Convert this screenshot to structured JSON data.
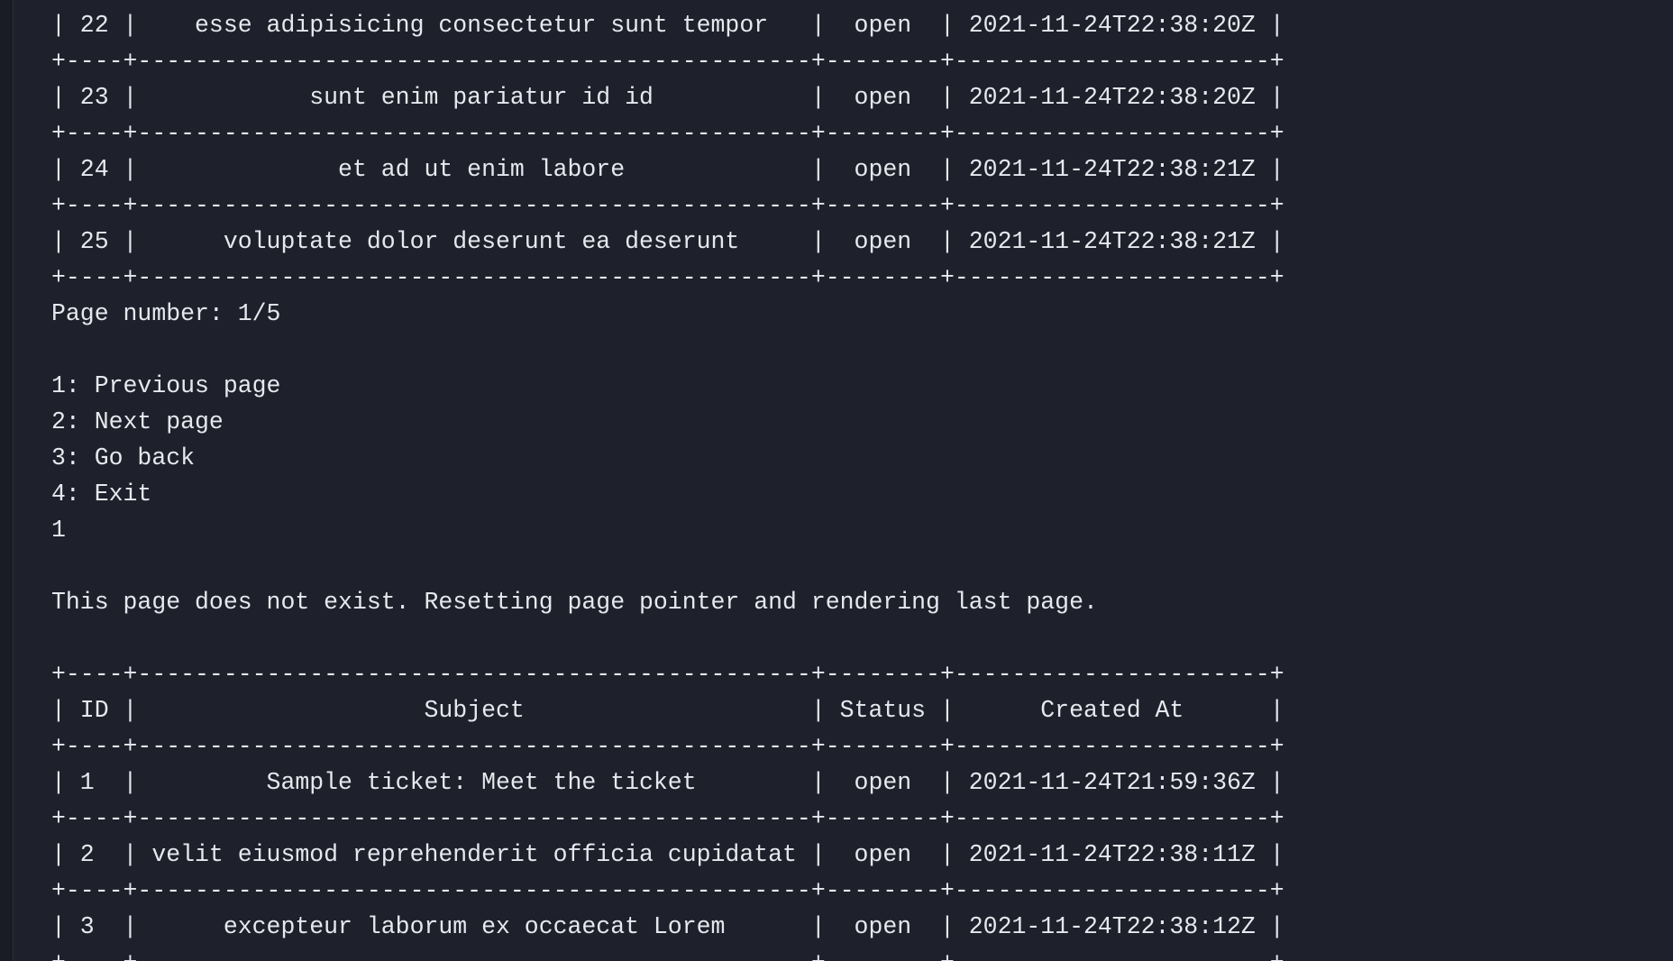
{
  "terminal": {
    "lines": [
      "| 22 |    esse adipisicing consectetur sunt tempor   |  open  | 2021-11-24T22:38:20Z |",
      "+----+-----------------------------------------------+--------+----------------------+",
      "| 23 |            sunt enim pariatur id id           |  open  | 2021-11-24T22:38:20Z |",
      "+----+-----------------------------------------------+--------+----------------------+",
      "| 24 |              et ad ut enim labore             |  open  | 2021-11-24T22:38:21Z |",
      "+----+-----------------------------------------------+--------+----------------------+",
      "| 25 |      voluptate dolor deserunt ea deserunt     |  open  | 2021-11-24T22:38:21Z |",
      "+----+-----------------------------------------------+--------+----------------------+",
      "Page number: 1/5",
      "",
      "1: Previous page",
      "2: Next page",
      "3: Go back",
      "4: Exit",
      "1",
      "",
      "This page does not exist. Resetting page pointer and rendering last page.",
      "",
      "+----+-----------------------------------------------+--------+----------------------+",
      "| ID |                    Subject                    | Status |      Created At      |",
      "+----+-----------------------------------------------+--------+----------------------+",
      "| 1  |         Sample ticket: Meet the ticket        |  open  | 2021-11-24T21:59:36Z |",
      "+----+-----------------------------------------------+--------+----------------------+",
      "| 2  | velit eiusmod reprehenderit officia cupidatat |  open  | 2021-11-24T22:38:11Z |",
      "+----+-----------------------------------------------+--------+----------------------+",
      "| 3  |      excepteur laborum ex occaecat Lorem      |  open  | 2021-11-24T22:38:12Z |",
      "+----+-----------------------------------------------+--------+----------------------+"
    ]
  }
}
